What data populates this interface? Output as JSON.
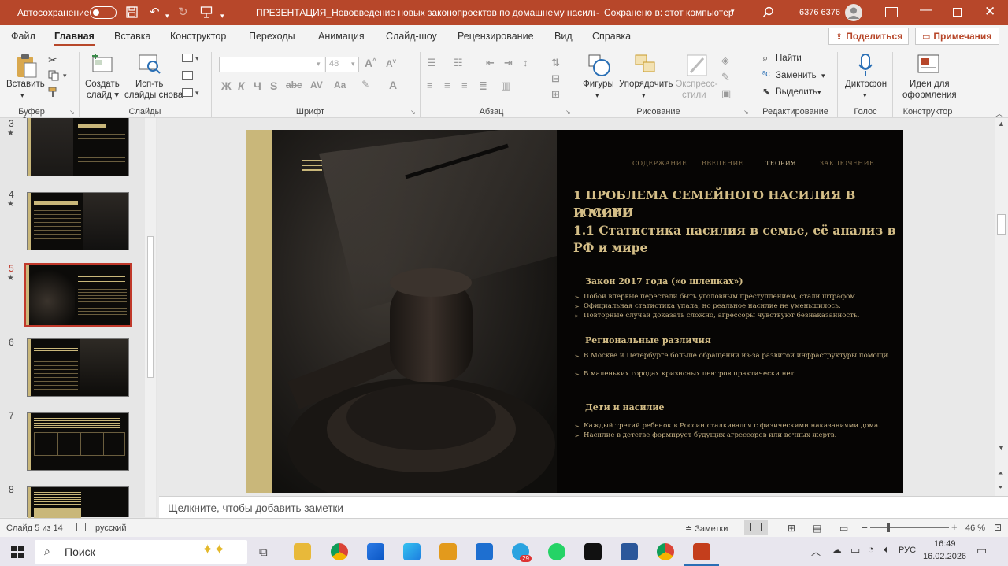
{
  "title_bar": {
    "autosave_label": "Автосохранение",
    "doc_title": "ПРЕЗЕНТАЦИЯ_Нововведение новых законопроектов по домашнему насилию в...",
    "save_status": "Сохранено в: этот компьютер",
    "user_name": "6376 6376"
  },
  "tabs": [
    "Файл",
    "Главная",
    "Вставка",
    "Конструктор",
    "Переходы",
    "Анимация",
    "Слайд-шоу",
    "Рецензирование",
    "Вид",
    "Справка"
  ],
  "share_label": "Поделиться",
  "comments_label": "Примечания",
  "ribbon": {
    "paste": "Вставить",
    "clipboard_group": "Буфер обмена",
    "new_slide": [
      "Создать",
      "слайд"
    ],
    "reuse_slides": [
      "Исп-ть",
      "слайды снова"
    ],
    "slides_group": "Слайды",
    "font_name": "",
    "font_size": "48",
    "font_group": "Шрифт",
    "paragraph_group": "Абзац",
    "shapes": "Фигуры",
    "arrange": "Упорядочить",
    "quick_styles": [
      "Экспресс-",
      "стили"
    ],
    "drawing_group": "Рисование",
    "find": "Найти",
    "replace": "Заменить",
    "select": "Выделить",
    "editing_group": "Редактирование",
    "dictate": "Диктофон",
    "voice_group": "Голос",
    "designer": [
      "Идеи для",
      "оформления"
    ],
    "designer_group": "Конструктор"
  },
  "thumbnails": [
    {
      "num": "3",
      "star": "★"
    },
    {
      "num": "4",
      "star": "★"
    },
    {
      "num": "5",
      "star": "★",
      "selected": true
    },
    {
      "num": "6",
      "star": ""
    },
    {
      "num": "7",
      "star": ""
    },
    {
      "num": "8",
      "star": ""
    }
  ],
  "slide": {
    "nav": [
      "СОДЕРЖАНИЕ",
      "ВВЕДЕНИЕ",
      "ТЕОРИЯ",
      "ЗАКЛЮЧЕНИЕ"
    ],
    "title_lines": [
      "1 ПРОБЛЕМА СЕМЕЙНОГО НАСИЛИЯ В РОССИИ",
      "И МИРЕ",
      "1.1 Статистика насилия в семье, её анализ в",
      "РФ и мире"
    ],
    "sections": [
      {
        "heading": "Закон 2017 года («о шлепках»)",
        "bullets": [
          "Побои впервые перестали быть уголовным преступлением, стали штрафом.",
          "Официальная статистика упала, но реальное насилие не уменьшилось.",
          "Повторные случаи доказать сложно, агрессоры чувствуют безнаказанность."
        ]
      },
      {
        "heading": "Региональные различия",
        "bullets": [
          "В Москве и Петербурге больше обращений из-за развитой инфраструктуры помощи.",
          "В маленьких городах кризисных центров практически нет."
        ]
      },
      {
        "heading": "Дети и насилие",
        "bullets": [
          "Каждый третий ребенок в России сталкивался с физическими наказаниями дома.",
          "Насилие в детстве формирует будущих агрессоров или вечных жертв."
        ]
      }
    ]
  },
  "notes_placeholder": "Щелкните, чтобы добавить заметки",
  "status_bar": {
    "slide_info": "Слайд 5 из 14",
    "language": "русский",
    "notes_button": "Заметки",
    "zoom": "46 %"
  },
  "taskbar": {
    "search_placeholder": "Поиск",
    "lang": "РУС",
    "time": "16:49",
    "date": "16.02.2026",
    "telegram_badge": "29"
  },
  "colors": {
    "accent": "#b7472a",
    "slide_gold": "#d4be87",
    "slide_bg": "#060504"
  }
}
